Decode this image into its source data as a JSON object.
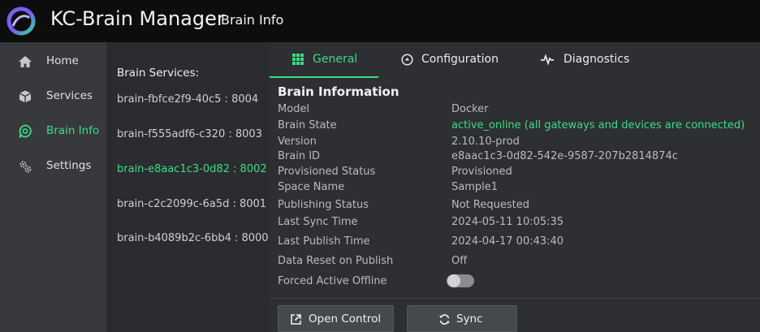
{
  "header": {
    "app_title": "KC-Brain Manager",
    "page_title": "Brain Info"
  },
  "nav": {
    "items": [
      {
        "label": "Home",
        "icon": "home-icon"
      },
      {
        "label": "Services",
        "icon": "cube-icon"
      },
      {
        "label": "Brain Info",
        "icon": "brain-icon",
        "active": true
      },
      {
        "label": "Settings",
        "icon": "gears-icon"
      }
    ]
  },
  "services": {
    "title": "Brain Services:",
    "items": [
      "brain-fbfce2f9-40c5 : 8004",
      "brain-f555adf6-c320 : 8003",
      "brain-e8aac1c3-0d82 : 8002",
      "brain-c2c2099c-6a5d : 8001",
      "brain-b4089b2c-6bb4 : 8000"
    ],
    "active_index": 2
  },
  "tabs": [
    {
      "label": "General",
      "icon": "grid-icon",
      "active": true
    },
    {
      "label": "Configuration",
      "icon": "config-icon"
    },
    {
      "label": "Diagnostics",
      "icon": "pulse-icon"
    }
  ],
  "info": {
    "title": "Brain Information",
    "rows": [
      {
        "label": "Model",
        "value": "Docker"
      },
      {
        "label": "Brain State",
        "value": "active_online (all gateways and devices  are connected)"
      },
      {
        "label": "Version",
        "value": "2.10.10-prod"
      },
      {
        "label": "Brain ID",
        "value": "e8aac1c3-0d82-542e-9587-207b2814874c"
      },
      {
        "label": "Provisioned Status",
        "value": "Provisioned"
      },
      {
        "label": "Space Name",
        "value": "Sample1"
      },
      {
        "label": "Publishing Status",
        "value": "Not Requested"
      },
      {
        "label": "Last Sync Time",
        "value": "2024-05-11  10:05:35"
      },
      {
        "label": "Last Publish Time",
        "value": "2024-04-17  00:43:40"
      },
      {
        "label": "Data Reset on Publish",
        "value": "Off"
      },
      {
        "label": "Forced Active Offline",
        "value": ""
      }
    ]
  },
  "buttons": {
    "open_control": "Open Control",
    "sync": "Sync"
  },
  "colors": {
    "accent": "#3ddc84",
    "topbar": "#0d0d0e",
    "nav_bg": "#37393c"
  }
}
